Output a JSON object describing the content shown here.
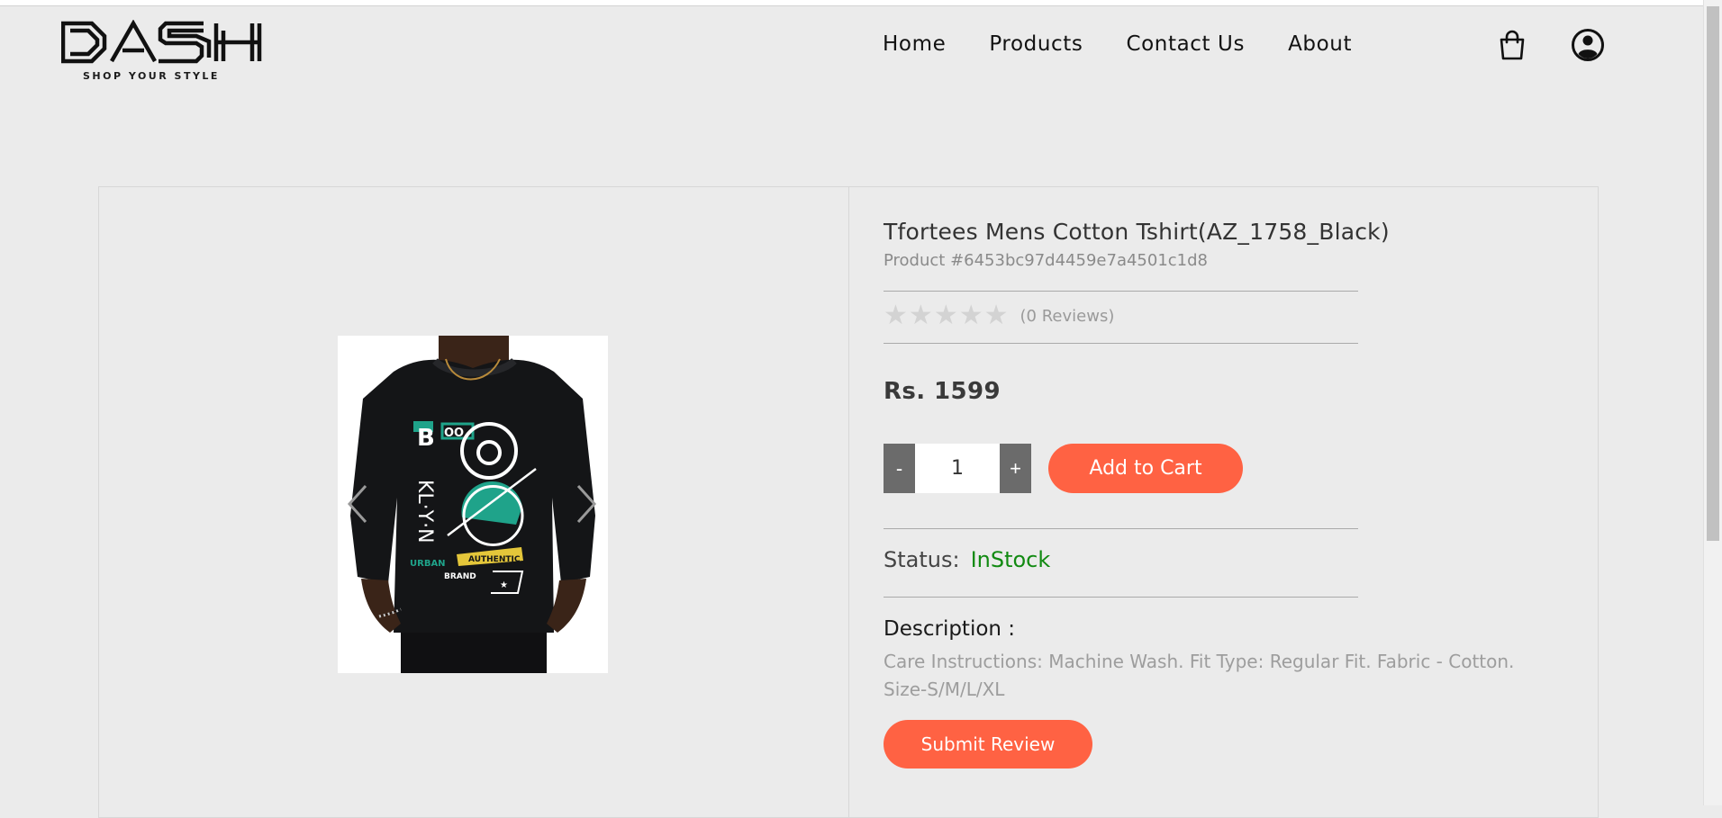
{
  "brand": {
    "name": "DASH",
    "tagline": "SHOP YOUR STYLE"
  },
  "nav": {
    "items": [
      {
        "label": "Home"
      },
      {
        "label": "Products"
      },
      {
        "label": "Contact Us"
      },
      {
        "label": "About"
      }
    ],
    "icons": [
      "shopping-bag-icon",
      "user-account-icon"
    ]
  },
  "product": {
    "title": "Tfortees Mens Cotton Tshirt(AZ_1758_Black)",
    "id_text": "Product #6453bc97d4459e7a4501c1d8",
    "rating": {
      "value": 0,
      "max": 5,
      "reviews_text": "(0 Reviews)"
    },
    "price": "Rs. 1599",
    "quantity": "1",
    "qty_minus": "-",
    "qty_plus": "+",
    "add_to_cart": "Add to Cart",
    "status_label": "Status:",
    "status_value": "InStock",
    "description_heading": "Description :",
    "description": "Care Instructions: Machine Wash. Fit Type: Regular Fit. Fabric - Cotton. Size-S/M/L/XL",
    "submit_review": "Submit Review",
    "image_print": {
      "badge": "AUTHENTIC",
      "urban": "URBAN",
      "brand": "BRAND"
    }
  },
  "colors": {
    "background": "#ebebeb",
    "accent": "#ff6243",
    "in_stock": "#128a12",
    "qty_button": "#6b6b6b"
  }
}
